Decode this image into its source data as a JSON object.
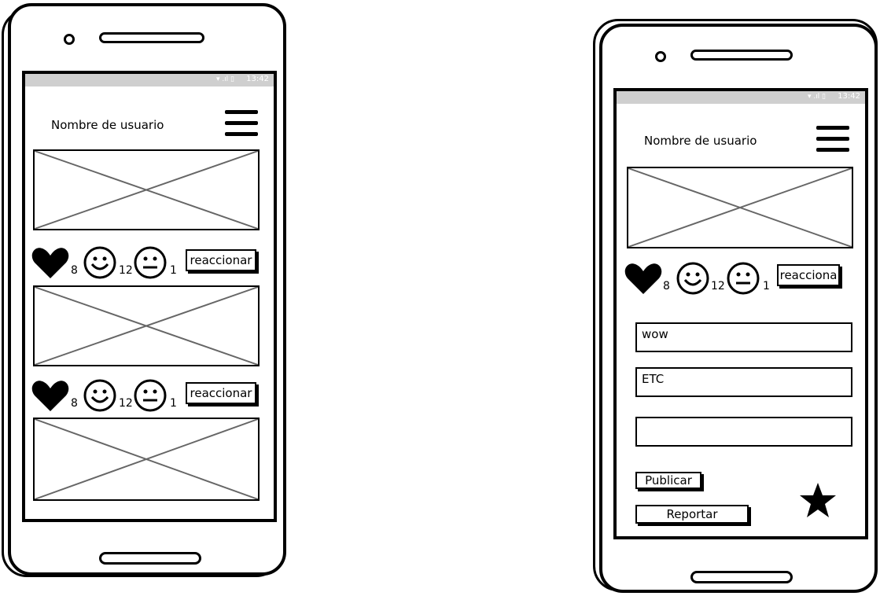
{
  "status_bar": {
    "time": "13:42",
    "signal": "▾ .ıl ▯"
  },
  "phone_left": {
    "username": "Nombre de usuario",
    "posts": [
      {
        "hearts": "8",
        "smiles": "12",
        "neutral": "1",
        "react_label": "reaccionar"
      },
      {
        "hearts": "8",
        "smiles": "12",
        "neutral": "1",
        "react_label": "reaccionar"
      }
    ]
  },
  "phone_right": {
    "username": "Nombre de usuario",
    "post": {
      "hearts": "8",
      "smiles": "12",
      "neutral": "1",
      "react_label": "reacciona"
    },
    "comments": [
      "wow",
      "ETC",
      ""
    ],
    "publish_label": "Publicar",
    "report_label": "Reportar"
  },
  "icons": [
    "menu-icon",
    "heart-icon",
    "smile-icon",
    "neutral-face-icon",
    "star-icon",
    "image-placeholder-icon"
  ]
}
